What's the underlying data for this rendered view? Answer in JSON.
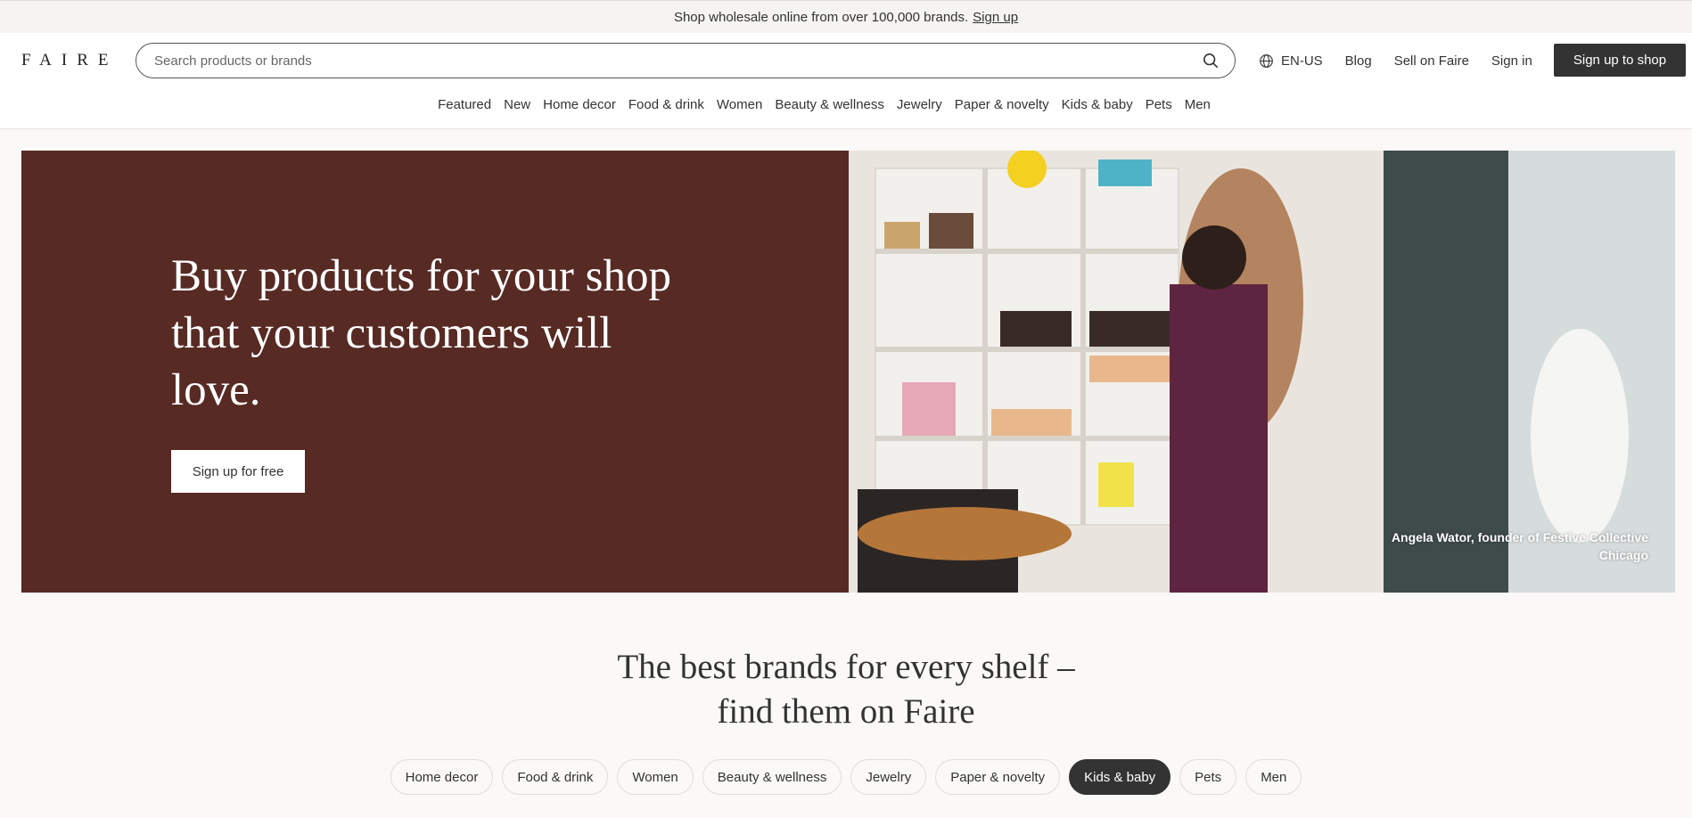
{
  "announcement": {
    "text": "Shop wholesale online from over 100,000 brands.",
    "link": "Sign up"
  },
  "header": {
    "logo": "FAIRE",
    "search_placeholder": "Search products or brands",
    "locale": "EN-US",
    "blog": "Blog",
    "sell": "Sell on Faire",
    "signin": "Sign in",
    "signup": "Sign up to shop"
  },
  "nav": [
    "Featured",
    "New",
    "Home decor",
    "Food & drink",
    "Women",
    "Beauty & wellness",
    "Jewelry",
    "Paper & novelty",
    "Kids & baby",
    "Pets",
    "Men"
  ],
  "hero": {
    "title": "Buy products for your shop that your customers will love.",
    "button": "Sign up for free",
    "caption_line1": "Angela Wator, founder of Festive Collective",
    "caption_line2": "Chicago"
  },
  "section": {
    "title_line1": "The best brands for every shelf –",
    "title_line2": "find them on Faire"
  },
  "pills": [
    "Home decor",
    "Food & drink",
    "Women",
    "Beauty & wellness",
    "Jewelry",
    "Paper & novelty",
    "Kids & baby",
    "Pets",
    "Men"
  ],
  "active_pill": "Kids & baby",
  "colors": {
    "hero_bg": "#572a24",
    "dark": "#333333"
  }
}
